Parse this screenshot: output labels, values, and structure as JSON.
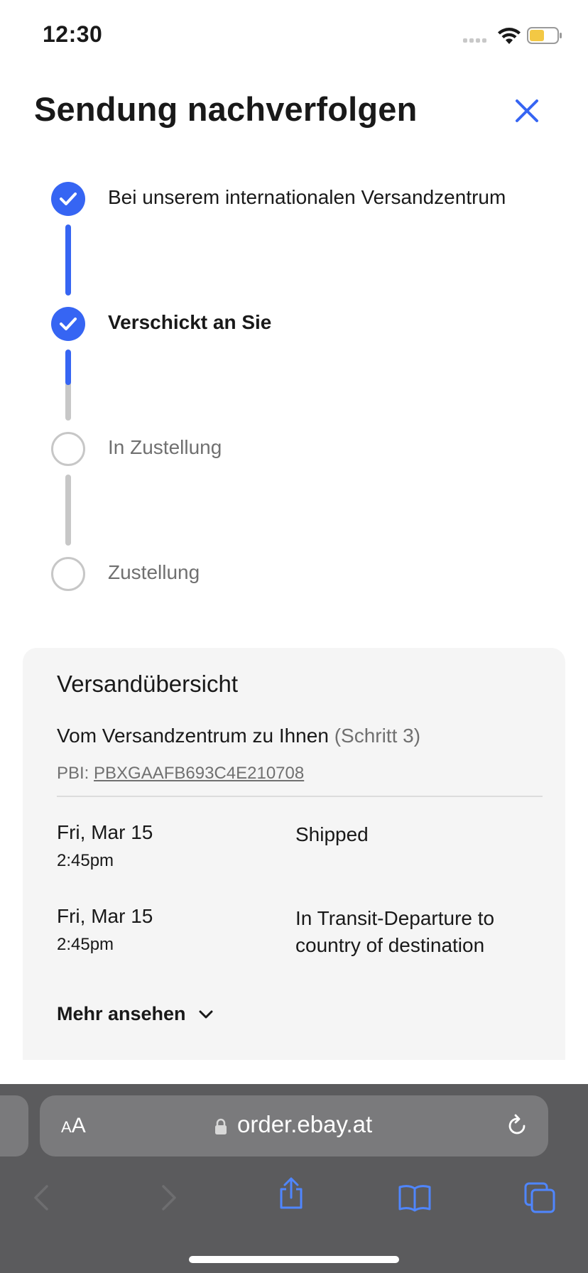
{
  "status_bar": {
    "time": "12:30"
  },
  "header": {
    "title": "Sendung nachverfolgen"
  },
  "timeline": {
    "steps": [
      {
        "label": "Bei unserem internationalen Versandzentrum",
        "state": "done"
      },
      {
        "label": "Verschickt an Sie",
        "state": "current"
      },
      {
        "label": "In Zustellung",
        "state": "todo"
      },
      {
        "label": "Zustellung",
        "state": "todo"
      }
    ],
    "connector_progress": [
      1.0,
      0.5,
      0.0
    ]
  },
  "overview": {
    "title": "Versandübersicht",
    "subtitle": "Vom Versandzentrum zu Ihnen",
    "step": "(Schritt 3)",
    "pbi_label": "PBI:",
    "pbi_value": "PBXGAAFB693C4E210708",
    "events": [
      {
        "date": "Fri, Mar 15",
        "time": "2:45pm",
        "description": "Shipped"
      },
      {
        "date": "Fri, Mar 15",
        "time": "2:45pm",
        "description": "In Transit-Departure to country of destination"
      }
    ],
    "more_label": "Mehr ansehen"
  },
  "browser": {
    "text_size_small": "A",
    "text_size_big": "A",
    "url": "order.ebay.at"
  },
  "colors": {
    "accent": "#3665f3",
    "inactive": "#c7c7c7",
    "muted_text": "#707070",
    "card_bg": "#f5f5f5",
    "toolbar_bg": "#5b5b5d"
  },
  "icons": [
    "signal-icon",
    "wifi-icon",
    "battery-icon",
    "close-icon",
    "checkmark-icon",
    "chevron-down-icon",
    "lock-icon",
    "reload-icon",
    "back-icon",
    "forward-icon",
    "share-icon",
    "bookmarks-icon",
    "tabs-icon"
  ]
}
